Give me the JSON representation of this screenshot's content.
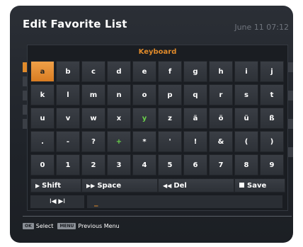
{
  "header": {
    "title": "Edit Favorite List",
    "datetime": "June 11 07:12"
  },
  "keyboard": {
    "title": "Keyboard",
    "rows": [
      [
        "a",
        "b",
        "c",
        "d",
        "e",
        "f",
        "g",
        "h",
        "i",
        "j"
      ],
      [
        "k",
        "l",
        "m",
        "n",
        "o",
        "p",
        "q",
        "r",
        "s",
        "t"
      ],
      [
        "u",
        "v",
        "w",
        "x",
        "y",
        "z",
        "ä",
        "ö",
        "ü",
        "ß"
      ],
      [
        ".",
        "-",
        "?",
        "+",
        "*",
        "'",
        "!",
        "&",
        "(",
        ")"
      ],
      [
        "0",
        "1",
        "2",
        "3",
        "4",
        "5",
        "6",
        "7",
        "8",
        "9"
      ]
    ],
    "selected_key": "a",
    "functions": {
      "shift": "Shift",
      "space": "Space",
      "del": "Del",
      "save": "Save"
    },
    "input": {
      "nav_glyphs": "I◀ ▶I",
      "value": "_"
    }
  },
  "footer": {
    "ok_tag": "OK",
    "ok_label": "Select",
    "menu_tag": "MENU",
    "menu_label": "Previous Menu"
  }
}
